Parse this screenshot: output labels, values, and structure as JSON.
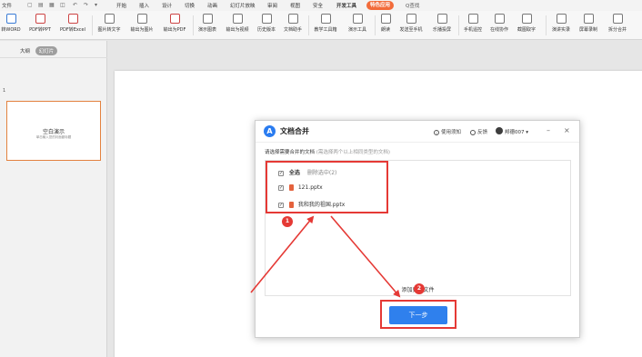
{
  "menubar": {
    "file": "文件",
    "tabs": [
      "开始",
      "插入",
      "设计",
      "切换",
      "动画",
      "幻灯片放映",
      "审阅",
      "视图",
      "安全",
      "开发工具",
      "特色应用"
    ],
    "active_tab": "特色应用",
    "search": "Q查找"
  },
  "ribbon": {
    "items": [
      "转WORD",
      "PDF转PPT",
      "PDF转Excel",
      "图片转文字",
      "输出为图片",
      "输出为PDF",
      "演示图表",
      "输出为视频",
      "历史版本",
      "文档助手",
      "教学工具箱",
      "演示工具",
      "朗读",
      "发送至手机",
      "乐播投屏",
      "手机遥控",
      "在线协作",
      "截图取字",
      "演讲实录",
      "屏幕录制",
      "拆分合并"
    ]
  },
  "leftpanel": {
    "tabs": [
      "大纲",
      "幻灯片"
    ],
    "slide_number": "1",
    "thumb_title": "空白演示",
    "thumb_subtitle": "单击输入您的封面副标题"
  },
  "dialog": {
    "title": "文档合并",
    "help": "使用须知",
    "feedback": "反馈",
    "user": "邦德007",
    "prompt": "请选择需要合并的文档",
    "hint": "(需选择两个以上相同类型的文档)",
    "select_all": "全选",
    "delete_selected": "删除选中(2)",
    "files": [
      "121.pptx",
      "我和我的祖国.pptx"
    ],
    "add_files": "添加更多文件",
    "next": "下一步"
  },
  "annotations": {
    "badge1": "1",
    "badge2": "2"
  },
  "colors": {
    "accent": "#f26b3a",
    "primary": "#2f80ed",
    "highlight": "#e53935"
  }
}
